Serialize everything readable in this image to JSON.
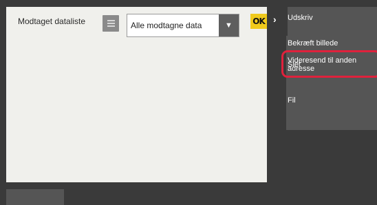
{
  "header": {
    "title": "Modtaget dataliste",
    "list_icon": "list-icon",
    "dropdown_value": "Alle modtagne data",
    "dropdown_icon": "triangle-down-icon",
    "ok_label": "OK",
    "expand_icon": "chevron-right-icon"
  },
  "menu": {
    "items": [
      {
        "label": "Udskriv"
      },
      {
        "label": "Bekræft billede"
      },
      {
        "label": "Videresend til anden adresse"
      },
      {
        "label": "Slet"
      },
      {
        "label": "Fil"
      }
    ]
  },
  "colors": {
    "panel_bg": "#f0f0ec",
    "background": "#3a3a3a",
    "menu_bg": "#555555",
    "ok_button": "#f0ca1c",
    "highlight": "#e0213c"
  }
}
